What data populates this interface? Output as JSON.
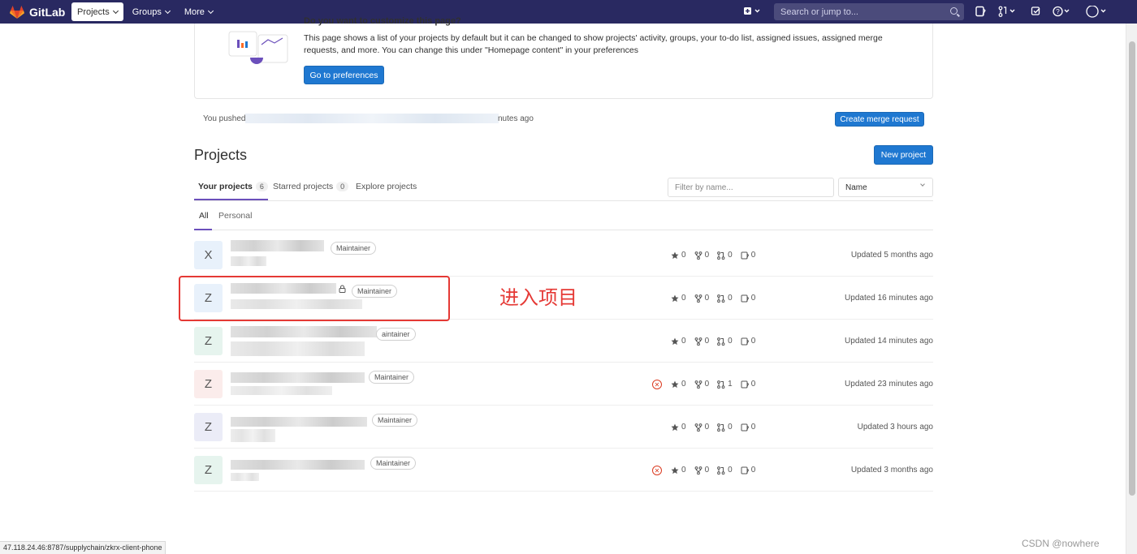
{
  "navbar": {
    "brand": "GitLab",
    "items": [
      {
        "label": "Projects",
        "active": true
      },
      {
        "label": "Groups",
        "active": false
      },
      {
        "label": "More",
        "active": false
      }
    ],
    "search_placeholder": "Search or jump to..."
  },
  "banner": {
    "title": "Do you want to customize this page?",
    "text": "This page shows a list of your projects by default but it can be changed to show projects' activity, groups, your to-do list, assigned issues, assigned merge requests, and more. You can change this under \"Homepage content\" in your preferences",
    "button": "Go to preferences"
  },
  "push": {
    "prefix": "You pushed",
    "suffix": "nutes ago",
    "button": "Create merge request"
  },
  "page": {
    "title": "Projects",
    "new_button": "New project"
  },
  "tabs": [
    {
      "label": "Your projects",
      "count": "6"
    },
    {
      "label": "Starred projects",
      "count": "0"
    },
    {
      "label": "Explore projects",
      "count": ""
    }
  ],
  "filter": {
    "placeholder": "Filter by name...",
    "sort": "Name"
  },
  "subtabs": [
    "All",
    "Personal"
  ],
  "projects": [
    {
      "letter": "X",
      "role": "Maintainer",
      "stars": "0",
      "forks": "0",
      "mrs": "0",
      "issues": "0",
      "updated": "Updated 5 months ago",
      "failed": false
    },
    {
      "letter": "Z",
      "role": "Maintainer",
      "stars": "0",
      "forks": "0",
      "mrs": "0",
      "issues": "0",
      "updated": "Updated 16 minutes ago",
      "failed": false
    },
    {
      "letter": "Z",
      "role": "aintainer",
      "stars": "0",
      "forks": "0",
      "mrs": "0",
      "issues": "0",
      "updated": "Updated 14 minutes ago",
      "failed": false
    },
    {
      "letter": "Z",
      "role": "Maintainer",
      "stars": "0",
      "forks": "0",
      "mrs": "1",
      "issues": "0",
      "updated": "Updated 23 minutes ago",
      "failed": true
    },
    {
      "letter": "Z",
      "role": "Maintainer",
      "stars": "0",
      "forks": "0",
      "mrs": "0",
      "issues": "0",
      "updated": "Updated 3 hours ago",
      "failed": false
    },
    {
      "letter": "Z",
      "role": "Maintainer",
      "stars": "0",
      "forks": "0",
      "mrs": "0",
      "issues": "0",
      "updated": "Updated 3 months ago",
      "failed": true
    }
  ],
  "annotation": "进入项目",
  "statusbar": "47.118.24.46:8787/supplychain/zkrx-client-phone",
  "watermark": "CSDN @nowhere"
}
